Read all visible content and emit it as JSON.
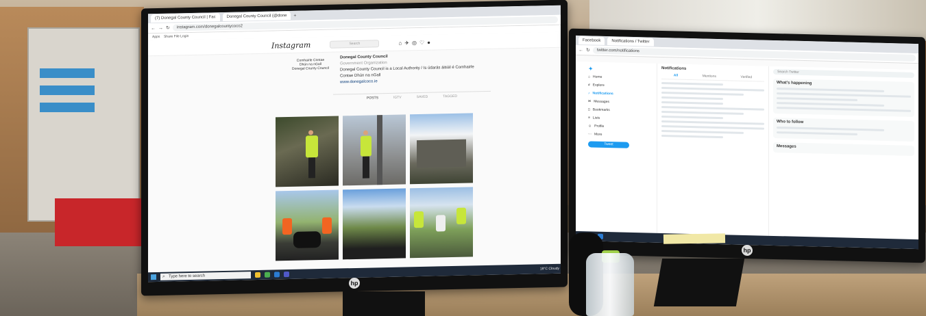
{
  "left_monitor": {
    "browser": {
      "tabs": [
        "(7) Donegal County Council | Fac",
        "Donegal County Council (@done"
      ],
      "url": "instagram.com/donegalcountycoco2",
      "bookmarks": [
        "Apps",
        "Share File Login"
      ]
    },
    "instagram": {
      "logo": "Instagram",
      "search_placeholder": "Search",
      "account_logo_lines": [
        "Comhairle Contae",
        "Dhún na nGall",
        "Donegal County Council"
      ],
      "profile_name": "Donegal County Council",
      "profile_category": "Government Organization",
      "profile_bio": "Donegal County Council is a Local Authority / Is údarás áitiúil é Comhairle Contae Dhún na nGall",
      "profile_link": "www.donegalcoco.ie",
      "tabs": [
        "POSTS",
        "IGTV",
        "SAVED",
        "TAGGED"
      ]
    },
    "taskbar": {
      "search_text": "Type here to search",
      "tray_text": "18°C Cloudy"
    }
  },
  "right_monitor": {
    "browser": {
      "tabs": [
        "Facebook",
        "Notifications / Twitter"
      ],
      "url": "twitter.com/notifications"
    },
    "twitter": {
      "nav": [
        "Home",
        "Explore",
        "Notifications",
        "Messages",
        "Bookmarks",
        "Lists",
        "Profile",
        "More"
      ],
      "tweet_button": "Tweet",
      "page_title": "Notifications",
      "filters": [
        "All",
        "Mentions",
        "Verified"
      ],
      "search_placeholder": "Search Twitter",
      "trending_title": "What's happening",
      "follow_title": "Who to follow",
      "messages_label": "Messages"
    }
  }
}
